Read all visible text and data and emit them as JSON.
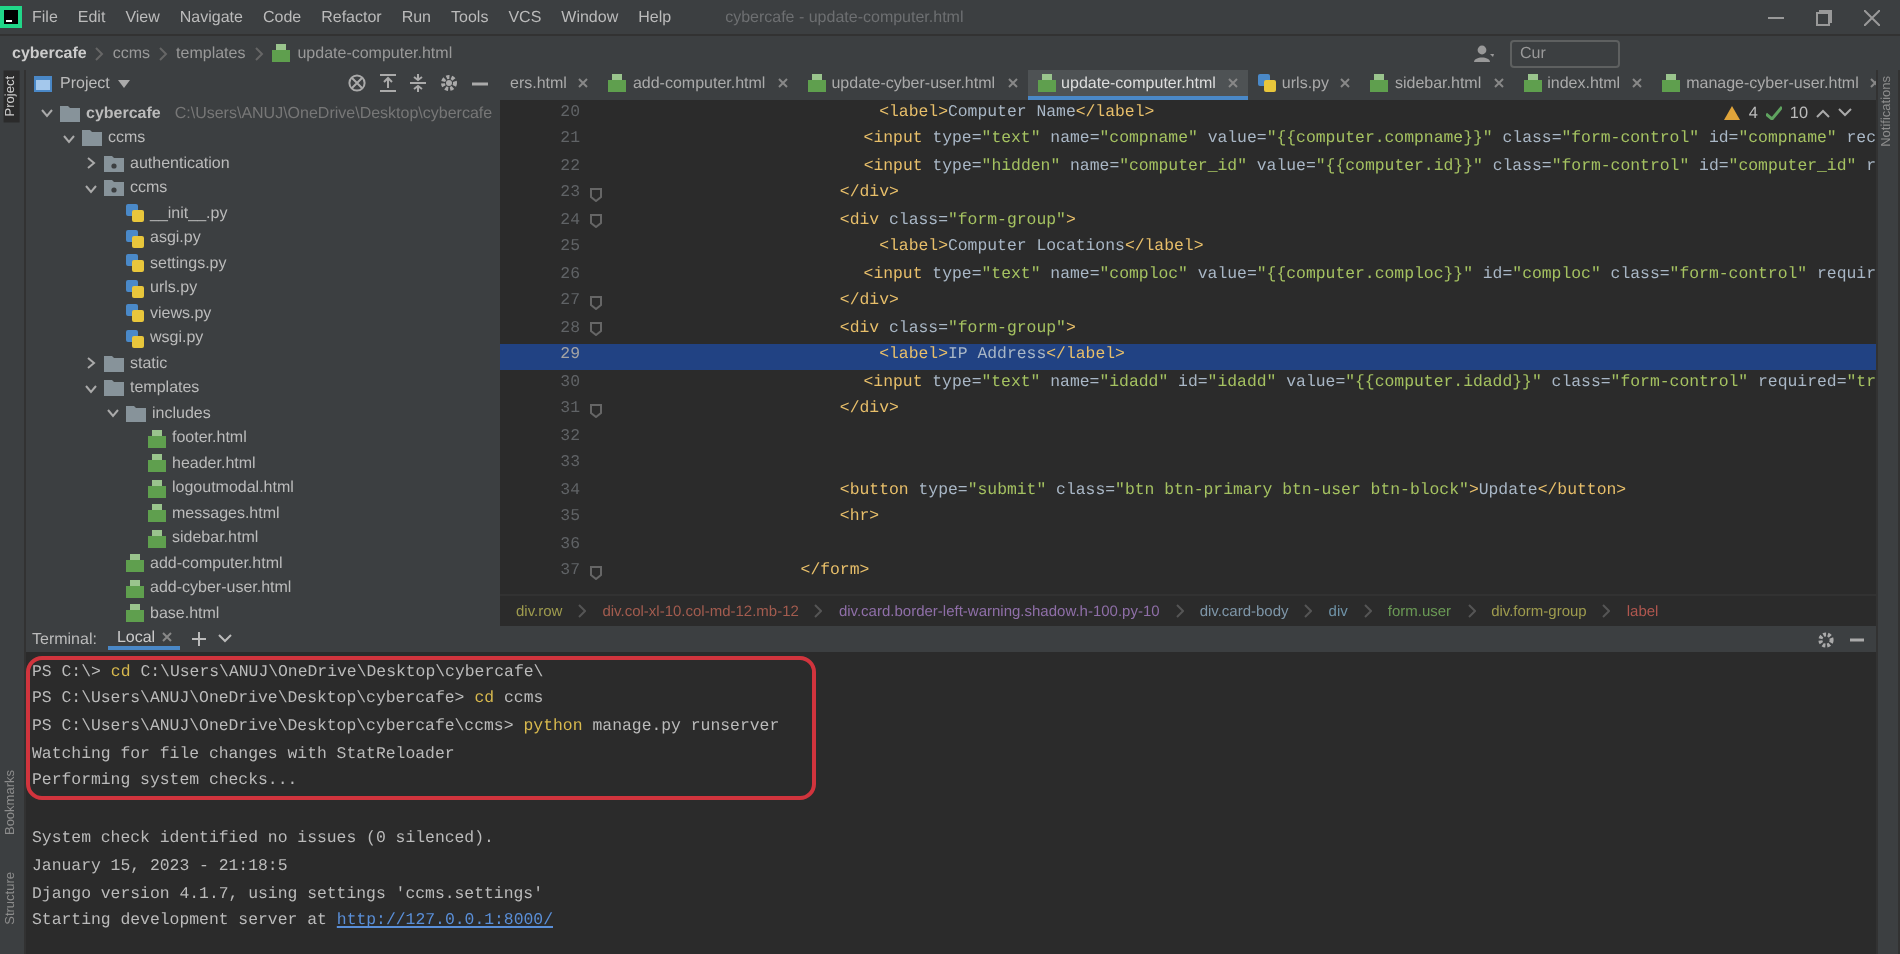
{
  "window": {
    "title": "cybercafe - update-computer.html"
  },
  "menu": [
    "File",
    "Edit",
    "View",
    "Navigate",
    "Code",
    "Refactor",
    "Run",
    "Tools",
    "VCS",
    "Window",
    "Help"
  ],
  "nav_path": [
    {
      "label": "cybercafe",
      "kind": "project"
    },
    {
      "label": "ccms",
      "kind": "folder"
    },
    {
      "label": "templates",
      "kind": "folder"
    },
    {
      "label": "update-computer.html",
      "kind": "html"
    }
  ],
  "search": {
    "value": "Cur"
  },
  "left_stripe": [
    "Project",
    "Bookmarks",
    "Structure"
  ],
  "right_stripe": [
    "Notifications"
  ],
  "project_panel": {
    "title": "Project",
    "tree": [
      {
        "label": "cybercafe",
        "path": "C:\\Users\\ANUJ\\OneDrive\\Desktop\\cybercafe",
        "kind": "folder",
        "expanded": true,
        "children": [
          {
            "label": "ccms",
            "kind": "folder",
            "expanded": true,
            "children": [
              {
                "label": "authentication",
                "kind": "package",
                "expanded": false
              },
              {
                "label": "ccms",
                "kind": "package",
                "expanded": true,
                "children": [
                  {
                    "label": "__init__.py",
                    "kind": "py"
                  },
                  {
                    "label": "asgi.py",
                    "kind": "py"
                  },
                  {
                    "label": "settings.py",
                    "kind": "py"
                  },
                  {
                    "label": "urls.py",
                    "kind": "py"
                  },
                  {
                    "label": "views.py",
                    "kind": "py"
                  },
                  {
                    "label": "wsgi.py",
                    "kind": "py"
                  }
                ]
              },
              {
                "label": "static",
                "kind": "folder",
                "expanded": false
              },
              {
                "label": "templates",
                "kind": "folder",
                "expanded": true,
                "children": [
                  {
                    "label": "includes",
                    "kind": "folder",
                    "expanded": true,
                    "children": [
                      {
                        "label": "footer.html",
                        "kind": "html"
                      },
                      {
                        "label": "header.html",
                        "kind": "html"
                      },
                      {
                        "label": "logoutmodal.html",
                        "kind": "html"
                      },
                      {
                        "label": "messages.html",
                        "kind": "html"
                      },
                      {
                        "label": "sidebar.html",
                        "kind": "html"
                      }
                    ]
                  },
                  {
                    "label": "add-computer.html",
                    "kind": "html"
                  },
                  {
                    "label": "add-cyber-user.html",
                    "kind": "html"
                  },
                  {
                    "label": "base.html",
                    "kind": "html"
                  }
                ]
              }
            ]
          }
        ]
      }
    ]
  },
  "editor_tabs": [
    {
      "label": "ers.html",
      "kind": "plain",
      "selected": false
    },
    {
      "label": "add-computer.html",
      "kind": "html",
      "selected": false
    },
    {
      "label": "update-cyber-user.html",
      "kind": "html",
      "selected": false
    },
    {
      "label": "update-computer.html",
      "kind": "html",
      "selected": true
    },
    {
      "label": "urls.py",
      "kind": "py",
      "selected": false
    },
    {
      "label": "sidebar.html",
      "kind": "html",
      "selected": false
    },
    {
      "label": "index.html",
      "kind": "html",
      "selected": false
    },
    {
      "label": "manage-cyber-user.html",
      "kind": "html",
      "selected": false
    }
  ],
  "inspections": {
    "warnings": "4",
    "passed": "10"
  },
  "code_lines": [
    {
      "number": "20",
      "text": "                            <label>Computer Name</label>",
      "current": false,
      "fold": false
    },
    {
      "number": "21",
      "text": "                            <input type=\"text\" name=\"compname\" value=\"{{computer.compname}}\" class=\"form-control\" id=\"compname\" rec",
      "current": false,
      "fold": false
    },
    {
      "number": "22",
      "text": "                            <input type=\"hidden\" name=\"computer_id\" value=\"{{computer.id}}\" class=\"form-control\" id=\"computer_id\" r",
      "current": false,
      "fold": false
    },
    {
      "number": "23",
      "text": "                        </div>",
      "current": false,
      "fold": true
    },
    {
      "number": "24",
      "text": "                        <div class=\"form-group\">",
      "current": false,
      "fold": true
    },
    {
      "number": "25",
      "text": "                            <label>Computer Locations</label>",
      "current": false,
      "fold": false
    },
    {
      "number": "26",
      "text": "                            <input type=\"text\" name=\"comploc\" value=\"{{computer.comploc}}\" id=\"comploc\" class=\"form-control\" requir",
      "current": false,
      "fold": false
    },
    {
      "number": "27",
      "text": "                        </div>",
      "current": false,
      "fold": true
    },
    {
      "number": "28",
      "text": "                        <div class=\"form-group\">",
      "current": false,
      "fold": true
    },
    {
      "number": "29",
      "text": "                            <label>IP Address</label>",
      "current": true,
      "fold": false
    },
    {
      "number": "30",
      "text": "                            <input type=\"text\" name=\"idadd\" id=\"idadd\" value=\"{{computer.idadd}}\" class=\"form-control\" required=\"tr",
      "current": false,
      "fold": false
    },
    {
      "number": "31",
      "text": "                        </div>",
      "current": false,
      "fold": true
    },
    {
      "number": "32",
      "current": false,
      "fold": false
    },
    {
      "number": "33",
      "current": false,
      "fold": false
    },
    {
      "number": "34",
      "text": "                        <button type=\"submit\" class=\"btn btn-primary btn-user btn-block\">Update</button>",
      "current": false,
      "fold": false
    },
    {
      "number": "35",
      "text": "                        <hr>",
      "current": false,
      "fold": false
    },
    {
      "number": "36",
      "current": false,
      "fold": false
    },
    {
      "number": "37",
      "text": "                    </form>",
      "current": false,
      "fold": true
    }
  ],
  "code_breadcrumbs": [
    {
      "label": "div.row",
      "color": "#9e9b4e"
    },
    {
      "label": "div.col-xl-10.col-md-12.mb-12",
      "color": "#a35c4f"
    },
    {
      "label": "div.card.border-left-warning.shadow.h-100.py-10",
      "color": "#8f6fa8"
    },
    {
      "label": "div.card-body",
      "color": "#7e96a8"
    },
    {
      "label": "div",
      "color": "#6f93a8"
    },
    {
      "label": "form.user",
      "color": "#6a9955"
    },
    {
      "label": "div.form-group",
      "color": "#9e9b4e"
    },
    {
      "label": "label",
      "color": "#b0574f"
    }
  ],
  "terminal": {
    "title": "Terminal:",
    "tabs": [
      {
        "label": "Local",
        "selected": true
      }
    ],
    "lines": [
      {
        "kind": "prompt",
        "prompt": "PS C:\\>",
        "command": "cd",
        "args": "C:\\Users\\ANUJ\\OneDrive\\Desktop\\cybercafe\\",
        "boxed": true
      },
      {
        "kind": "prompt",
        "prompt": "PS C:\\Users\\ANUJ\\OneDrive\\Desktop\\cybercafe>",
        "command": "cd",
        "args": "ccms",
        "boxed": true
      },
      {
        "kind": "prompt",
        "prompt": "PS C:\\Users\\ANUJ\\OneDrive\\Desktop\\cybercafe\\ccms>",
        "command": "python",
        "args": "manage.py runserver",
        "boxed": true
      },
      {
        "kind": "output",
        "text": "Watching for file changes with StatReloader",
        "boxed": true
      },
      {
        "kind": "output",
        "text": "Performing system checks...",
        "boxed": true
      },
      {
        "kind": "blank",
        "boxed": false
      },
      {
        "kind": "output",
        "text": "System check identified no issues (0 silenced).",
        "boxed": false
      },
      {
        "kind": "output",
        "text": "January 15, 2023 - 21:18:5",
        "boxed": false
      },
      {
        "kind": "output",
        "text": "Django version 4.1.7, using settings 'ccms.settings'",
        "boxed": false
      },
      {
        "kind": "link",
        "text": "Starting development server at",
        "link": "http://127.0.0.1:8000/",
        "boxed": false
      }
    ]
  }
}
